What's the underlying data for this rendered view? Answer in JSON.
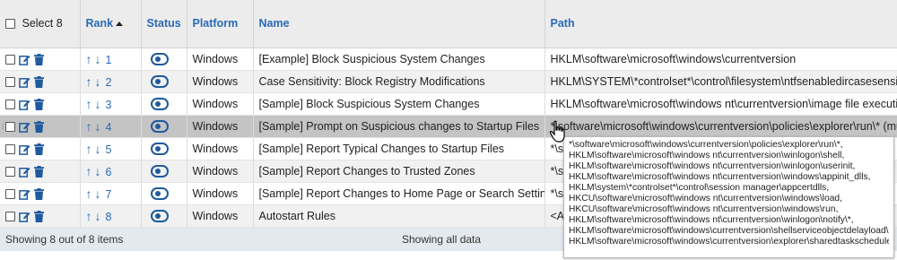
{
  "header": {
    "select_label": "Select 8",
    "rank": "Rank",
    "status": "Status",
    "platform": "Platform",
    "name": "Name",
    "path": "Path"
  },
  "rows": [
    {
      "rank": "1",
      "platform": "Windows",
      "name": "[Example] Block Suspicious System Changes",
      "path": "HKLM\\software\\microsoft\\windows\\currentversion"
    },
    {
      "rank": "2",
      "platform": "Windows",
      "name": "Case Sensitivity: Block Registry Modifications",
      "path": "HKLM\\SYSTEM\\*controlset*\\control\\filesystem\\ntfsenabledircasesensitivity"
    },
    {
      "rank": "3",
      "platform": "Windows",
      "name": "[Sample] Block Suspicious System Changes",
      "path": "HKLM\\software\\microsoft\\windows nt\\currentversion\\image file execution"
    },
    {
      "rank": "4",
      "platform": "Windows",
      "name": "[Sample] Prompt on Suspicious changes to Startup Files",
      "path": "*\\software\\microsoft\\windows\\currentversion\\policies\\explorer\\run\\* (mult"
    },
    {
      "rank": "5",
      "platform": "Windows",
      "name": "[Sample] Report Typical Changes to Startup Files",
      "path": "*\\s"
    },
    {
      "rank": "6",
      "platform": "Windows",
      "name": "[Sample] Report Changes to Trusted Zones",
      "path": "*\\s"
    },
    {
      "rank": "7",
      "platform": "Windows",
      "name": "[Sample] Report Changes to Home Page or Search Settings",
      "path": "*\\s"
    },
    {
      "rank": "8",
      "platform": "Windows",
      "name": "Autostart Rules",
      "path": "<A"
    }
  ],
  "footer": {
    "showing_items": "Showing 8 out of 8 items",
    "showing_all": "Showing all data"
  },
  "tooltip": {
    "lines": [
      "*\\software\\microsoft\\windows\\currentversion\\policies\\explorer\\run\\*,",
      "HKLM\\software\\microsoft\\windows nt\\currentversion\\winlogon\\shell,",
      "HKLM\\software\\microsoft\\windows nt\\currentversion\\winlogon\\userinit,",
      "HKLM\\software\\microsoft\\windows nt\\currentversion\\windows\\appinit_dlls,",
      "HKLM\\system\\*controlset*\\control\\session manager\\appcertdlls,",
      "HKCU\\software\\microsoft\\windows nt\\currentversion\\windows\\load,",
      "HKCU\\software\\microsoft\\windows nt\\currentversion\\windows\\run,",
      "HKLM\\software\\microsoft\\windows nt\\currentversion\\winlogon\\notify\\*,",
      "HKLM\\software\\microsoft\\windows\\currentversion\\shellserviceobjectdelayload\\*,",
      "HKLM\\software\\microsoft\\windows\\currentversion\\explorer\\sharedtaskscheduler\\*"
    ]
  },
  "colors": {
    "accent": "#2a6ab6",
    "header_bg": "#ececec",
    "highlight_row": "#c4c4c4",
    "footer_bg": "#e4e9ef"
  },
  "icons": [
    "checkbox",
    "edit-icon",
    "trash-icon",
    "arrow-up-icon",
    "arrow-down-icon",
    "toggle-icon",
    "sort-ascending-icon",
    "pointer-cursor-icon"
  ]
}
